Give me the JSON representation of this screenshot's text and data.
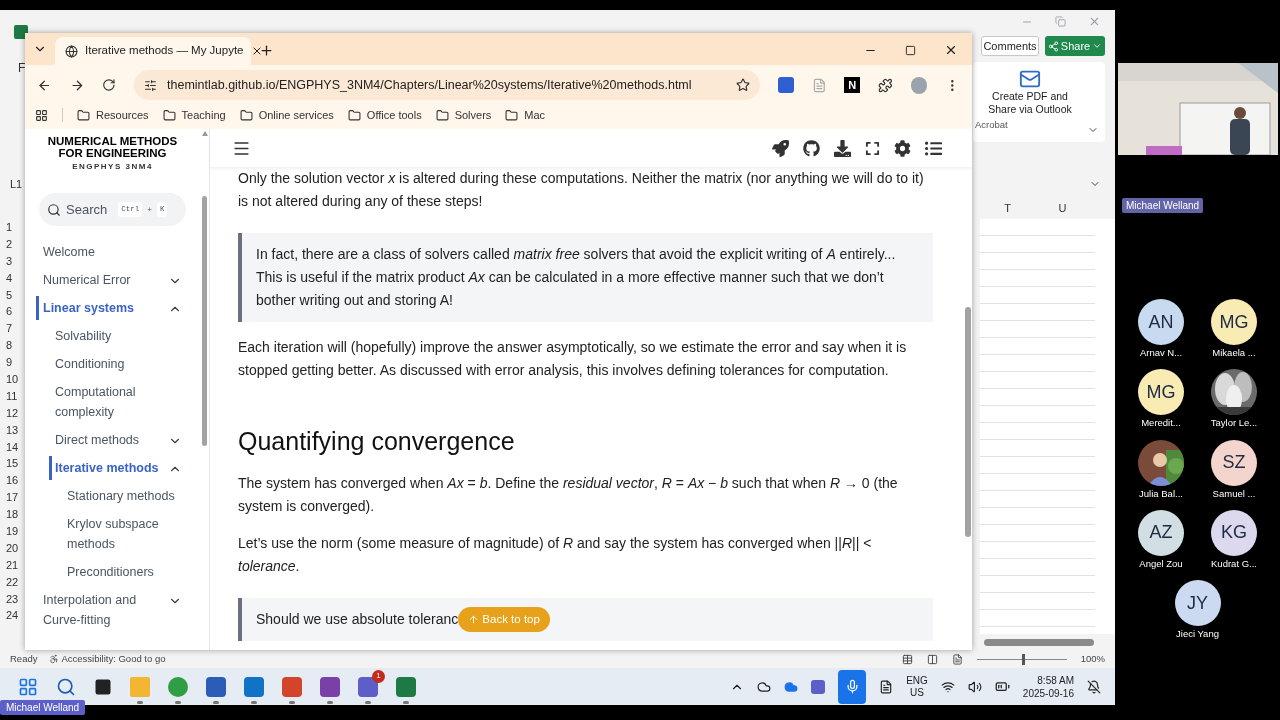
{
  "excel": {
    "ribbon_letter": "F",
    "buttons": [
      {
        "label": "Comments",
        "kind": "comments"
      },
      {
        "label": "Share",
        "kind": "share"
      }
    ],
    "acrobat": {
      "action": "Create PDF and Share via Outlook",
      "group": "Acrobat"
    },
    "name_box": "L1",
    "columns": [
      "T",
      "U"
    ],
    "rows": [
      "1",
      "2",
      "3",
      "4",
      "5",
      "6",
      "7",
      "8",
      "9",
      "10",
      "11",
      "12",
      "13",
      "14",
      "15",
      "16",
      "17",
      "18",
      "19",
      "20",
      "21",
      "22",
      "23",
      "24"
    ],
    "status": "Ready",
    "accessibility": "Accessibility: Good to go",
    "zoom": "100%"
  },
  "browser": {
    "tab_title": "Iterative methods — My Jupyte",
    "url": "themintlab.github.io/ENGPHYS_3NM4/Chapters/Linear%20systems/Iterative%20methods.html",
    "extension_letter": "N",
    "bookmarks": [
      "Resources",
      "Teaching",
      "Online services",
      "Office tools",
      "Solvers",
      "Mac"
    ],
    "page": {
      "logo_title": "NUMERICAL METHODS FOR ENGINEERING",
      "logo_subtitle": "ENGPHYS 3NM4",
      "search": {
        "placeholder": "Search",
        "keys": [
          "Ctrl",
          "+",
          "K"
        ]
      },
      "sidebar": [
        {
          "label": "Welcome",
          "selected": false
        },
        {
          "label": "Numerical Error",
          "selected": false,
          "expanded": false
        },
        {
          "label": "Linear systems",
          "selected": true,
          "expanded": true,
          "children": [
            {
              "label": "Solvability",
              "selected": false
            },
            {
              "label": "Conditioning",
              "selected": false
            },
            {
              "label": "Computational complexity",
              "selected": false
            },
            {
              "label": "Direct methods",
              "selected": false,
              "expanded": false
            },
            {
              "label": "Iterative methods",
              "selected": true,
              "expanded": true,
              "children": [
                {
                  "label": "Stationary methods",
                  "selected": false
                },
                {
                  "label": "Krylov subspace methods",
                  "selected": false
                },
                {
                  "label": "Preconditioners",
                  "selected": false
                }
              ]
            }
          ]
        },
        {
          "label": "Interpolation and Curve-fitting",
          "selected": false,
          "expanded": false
        }
      ],
      "blocks": [
        {
          "kind": "paragraph",
          "text": "Only the solution vector *x* is altered during these computations. Neither the matrix (nor anything we will do to it) is not altered during any of these steps!"
        },
        {
          "kind": "note",
          "text": "In fact, there are a class of solvers called *matrix free* solvers that avoid the explicit writing of *A* entirely... This is useful if the matrix product *Ax* can be calculated in a more effective manner such that we don’t bother writing out and storing A!"
        },
        {
          "kind": "paragraph",
          "text": "Each iteration will (hopefully) improve the answer asymptotically, so we estimate the error and say when it is stopped getting better. As discussed with error analysis, this involves defining tolerances for computation."
        },
        {
          "kind": "heading",
          "text": "Quantifying convergence"
        },
        {
          "kind": "paragraph",
          "text": "The system has converged when *Ax* = *b*. Define the *residual vector*, *R* = *Ax* − *b* such that when *R* → 0 (the system is converged)."
        },
        {
          "kind": "paragraph",
          "text": "Let’s use the norm (some measure of magnitude) of *R* and say the system has converged when ||*R*|| < *tolerance*."
        },
        {
          "kind": "note",
          "text": "Should we use absolute toleranc"
        }
      ],
      "back_to_top": "Back to top"
    }
  },
  "taskbar": {
    "apps": [
      {
        "color": "#f2b632",
        "kind": "folder",
        "running": true
      },
      {
        "color": "#2f9e44",
        "kind": "browser",
        "running": true
      },
      {
        "color": "#2b5cb8",
        "kind": "doc",
        "running": true
      },
      {
        "color": "#1173c6",
        "kind": "doc",
        "running": true
      },
      {
        "color": "#d2452b",
        "kind": "doc",
        "running": true
      },
      {
        "color": "#7b3fa8",
        "kind": "doc",
        "running": true
      },
      {
        "color": "#5b5fc7",
        "kind": "doc",
        "running": true,
        "badge": "1"
      },
      {
        "color": "#1d7a45",
        "kind": "doc",
        "running": true
      }
    ],
    "language": "ENG",
    "region": "US",
    "time": "8:58 AM",
    "date": "2025-09-16"
  },
  "teams": {
    "video_name": "Michael Welland",
    "presenter_name": "Michael Welland",
    "participants": [
      {
        "kind": "initials",
        "initials": "AN",
        "name": "Arnav N...",
        "color": "#c8daf0"
      },
      {
        "kind": "initials",
        "initials": "MG",
        "name": "Mikaela ...",
        "color": "#f8ebb4"
      },
      {
        "kind": "initials",
        "initials": "MG",
        "name": "Meredit...",
        "color": "#f8ebb4"
      },
      {
        "kind": "picture",
        "name": "Taylor Le..."
      },
      {
        "kind": "picture",
        "name": "Julia Bal..."
      },
      {
        "kind": "initials",
        "initials": "SZ",
        "name": "Samuel ...",
        "color": "#f3d5cd"
      },
      {
        "kind": "initials",
        "initials": "AZ",
        "name": "Angel Zou",
        "color": "#d1dfe4"
      },
      {
        "kind": "initials",
        "initials": "KG",
        "name": "Kudrat G...",
        "color": "#dcd9ef"
      },
      {
        "kind": "initials",
        "initials": "JY",
        "name": "Jieci Yang",
        "color": "#cbdaf1"
      }
    ]
  }
}
